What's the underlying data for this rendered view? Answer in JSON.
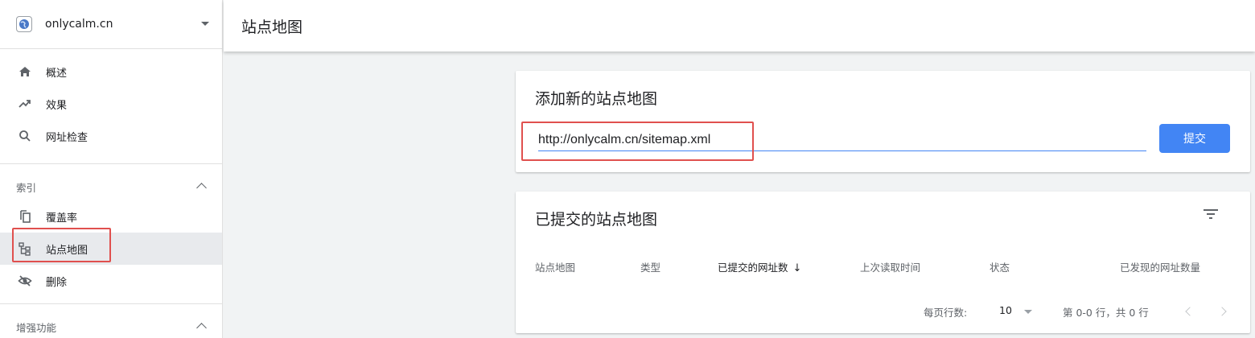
{
  "property": {
    "name": "onlycalm.cn"
  },
  "sidebar": {
    "items": [
      {
        "label": "概述",
        "icon": "home-icon"
      },
      {
        "label": "效果",
        "icon": "trending-up-icon"
      },
      {
        "label": "网址检查",
        "icon": "search-icon"
      }
    ],
    "sections": [
      {
        "label": "索引",
        "items": [
          {
            "label": "覆盖率",
            "icon": "copy-icon"
          },
          {
            "label": "站点地图",
            "icon": "sitemap-icon",
            "active": true
          },
          {
            "label": "删除",
            "icon": "visibility-off-icon"
          }
        ]
      },
      {
        "label": "增强功能"
      }
    ]
  },
  "header": {
    "title": "站点地图"
  },
  "add_card": {
    "title": "添加新的站点地图",
    "input_value": "http://onlycalm.cn/sitemap.xml",
    "submit_label": "提交"
  },
  "submitted_card": {
    "title": "已提交的站点地图",
    "columns": [
      "站点地图",
      "类型",
      "已提交的网址数",
      "上次读取时间",
      "状态",
      "已发现的网址数量"
    ],
    "sorted_column_arrow": "↓",
    "pager": {
      "rows_label": "每页行数:",
      "rows_value": "10",
      "range_text": "第 0-0 行，共 0 行"
    }
  },
  "colors": {
    "accent": "#4285f4",
    "highlight": "#e0504e"
  }
}
